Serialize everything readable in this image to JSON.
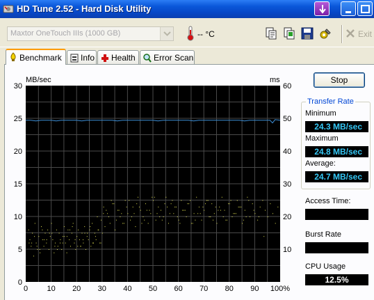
{
  "window": {
    "title": "HD Tune 2.52 - Hard Disk Utility"
  },
  "toolbar": {
    "drive": "Maxtor OneTouch IIIs (1000 GB)",
    "temperature": "-- °C",
    "exit_label": "Exit",
    "icons": [
      "copy-text-icon",
      "copy-image-icon",
      "save-icon",
      "options-icon",
      "exit-icon"
    ]
  },
  "tabs": [
    {
      "label": "Benchmark",
      "icon": "benchmark-icon",
      "active": true
    },
    {
      "label": "Info",
      "icon": "info-icon",
      "active": false
    },
    {
      "label": "Health",
      "icon": "health-icon",
      "active": false
    },
    {
      "label": "Error Scan",
      "icon": "error-scan-icon",
      "active": false
    }
  ],
  "controls": {
    "stop_label": "Stop"
  },
  "transfer_rate": {
    "title": "Transfer Rate",
    "minimum_label": "Minimum",
    "minimum": "24.3 MB/sec",
    "maximum_label": "Maximum",
    "maximum": "24.8 MB/sec",
    "average_label": "Average:",
    "average": "24.7 MB/sec"
  },
  "access_time": {
    "label": "Access Time:",
    "value": ""
  },
  "burst_rate": {
    "label": "Burst Rate",
    "value": ""
  },
  "cpu_usage": {
    "label": "CPU Usage",
    "value": "12.5%"
  },
  "colors": {
    "chart_bg": "#000000",
    "grid": "#4a4a4a",
    "transfer_line": "#3c8fd8",
    "access_dots": "#e4e452",
    "stat_text": "#35c7f5"
  },
  "chart_data": {
    "type": "line",
    "left_unit": "MB/sec",
    "right_unit": "ms",
    "left_ticks": [
      "30",
      "25",
      "20",
      "15",
      "10",
      "5",
      "0"
    ],
    "right_ticks": [
      "60",
      "50",
      "40",
      "30",
      "20",
      "10"
    ],
    "x_ticks": [
      "0",
      "10",
      "20",
      "30",
      "40",
      "50",
      "60",
      "70",
      "80",
      "90",
      "100%"
    ],
    "xlim": [
      0,
      100
    ],
    "ylim_left": [
      0,
      30
    ],
    "ylim_right": [
      0,
      60
    ],
    "grid": true,
    "series": [
      {
        "axis": "left",
        "x": [
          0,
          2,
          4,
          6,
          8,
          10,
          12,
          14,
          16,
          18,
          20,
          22,
          24,
          26,
          28,
          30,
          32,
          34,
          36,
          38,
          40,
          42,
          44,
          46,
          48,
          50,
          52,
          54,
          56,
          58,
          60,
          62,
          64,
          66,
          68,
          70,
          72,
          74,
          76,
          78,
          80,
          82,
          84,
          86,
          88,
          90,
          92,
          94,
          96,
          97,
          98,
          100
        ],
        "values": [
          24.7,
          24.7,
          24.6,
          24.7,
          24.7,
          24.7,
          24.6,
          24.7,
          24.7,
          24.7,
          24.7,
          24.6,
          24.7,
          24.7,
          24.7,
          24.7,
          24.7,
          24.7,
          24.6,
          24.7,
          24.7,
          24.7,
          24.7,
          24.7,
          24.7,
          24.7,
          24.6,
          24.7,
          24.7,
          24.7,
          24.7,
          24.7,
          24.7,
          24.6,
          24.7,
          24.7,
          24.7,
          24.7,
          24.7,
          24.7,
          24.7,
          24.7,
          24.7,
          24.6,
          24.7,
          24.7,
          24.7,
          24.7,
          24.7,
          24.3,
          24.8,
          24.7
        ]
      }
    ],
    "scatter_axis": "right",
    "scatter_x": [
      1,
      1.5,
      2,
      2.5,
      3,
      3.5,
      4,
      4.5,
      5,
      5.5,
      6,
      6.5,
      7,
      7.5,
      8,
      8.5,
      9,
      9.5,
      10,
      10.5,
      11,
      11.5,
      12,
      12.5,
      13,
      13.5,
      14,
      14.5,
      15,
      15.5,
      16,
      16.5,
      17,
      17.5,
      18,
      18.5,
      19,
      19.5,
      20,
      20.5,
      21,
      21.5,
      22,
      22.5,
      23,
      23.5,
      24,
      24.5,
      25,
      25.5,
      26,
      26.5,
      27,
      27.5,
      28,
      28.5,
      29,
      29.5,
      30,
      30.5,
      31,
      32,
      33,
      34,
      35,
      36,
      37,
      38,
      39,
      40,
      41,
      42,
      43,
      44,
      45,
      46,
      47,
      48,
      49,
      50,
      51,
      52,
      53,
      54,
      55,
      56,
      57,
      58,
      59,
      60,
      61,
      62,
      63,
      64,
      65,
      66,
      67,
      68,
      69,
      70,
      71,
      72,
      73,
      74,
      75,
      76,
      77,
      78,
      79,
      80,
      81,
      82,
      83,
      84,
      85,
      86,
      87,
      88,
      89,
      90,
      91,
      92,
      93,
      94,
      95,
      96,
      97,
      98,
      99,
      1.2,
      3.3,
      5.4,
      7.1,
      9.2,
      11.3,
      13.4,
      15.1,
      17.2,
      19.3,
      21.4,
      23.1,
      25.2,
      27.3,
      29.4,
      31.5,
      33.5,
      35.5,
      37.5,
      39.5,
      41.5,
      43.5,
      45.5,
      47.5,
      49.5,
      51.5,
      53.5,
      55.5,
      57.5,
      59.5,
      61.5,
      63.5,
      65.5,
      67.5,
      69.5,
      71.5,
      73.5,
      75.5,
      77.5,
      79.5,
      81.5,
      83.5,
      85.5,
      87.5,
      89.5,
      91.5,
      93.5,
      2.2,
      4.3,
      6.4,
      8.1,
      10.2,
      12.3,
      14.4,
      16.1,
      18.2,
      20.3,
      22.4,
      24.1,
      26.2,
      28.3,
      30.4,
      32.5,
      34.5,
      36.5,
      38.5,
      40.5,
      42.5,
      44.5,
      46.5,
      48.5,
      50.5,
      52.5,
      54.5,
      56.5,
      58.5,
      60.5,
      62.5,
      64.5,
      66.5,
      68.5,
      70.5,
      72.5,
      74.5,
      76.5,
      78.5,
      80.5,
      82.5,
      84.5,
      86.5,
      88.5,
      90.5,
      92.5,
      94.5
    ],
    "scatter_y": [
      16,
      13,
      11,
      15,
      8,
      18,
      12,
      10,
      14,
      9,
      17,
      13,
      11,
      15,
      12,
      16,
      10,
      14,
      18,
      13,
      9,
      12,
      16,
      11,
      15,
      13,
      10,
      14,
      17,
      12,
      9,
      16,
      13,
      11,
      15,
      18,
      12,
      10,
      14,
      16,
      13,
      11,
      15,
      12,
      17,
      10,
      14,
      13,
      16,
      11,
      18,
      12,
      15,
      13,
      20,
      16,
      12,
      19,
      15,
      23,
      17,
      21,
      18,
      24,
      16,
      22,
      20,
      18,
      25,
      21,
      19,
      23,
      17,
      26,
      22,
      20,
      24,
      18,
      21,
      25,
      19,
      23,
      22,
      20,
      26,
      18,
      24,
      21,
      23,
      19,
      25,
      22,
      20,
      24,
      18,
      21,
      26,
      23,
      19,
      22,
      25,
      20,
      24,
      21,
      18,
      23,
      26,
      22,
      19,
      24,
      20,
      21,
      25,
      23,
      18,
      22,
      26,
      20,
      24,
      21,
      19,
      23,
      25,
      22,
      20,
      24,
      21,
      18,
      23,
      12,
      14,
      10,
      13,
      15,
      11,
      12,
      14,
      16,
      13,
      11,
      15,
      17,
      14,
      12,
      22,
      25,
      19,
      21,
      23,
      20,
      24,
      18,
      22,
      26,
      21,
      19,
      23,
      25,
      20,
      22,
      24,
      18,
      21,
      23,
      25,
      19,
      22,
      20,
      24,
      21,
      23,
      19,
      25,
      22,
      20,
      14,
      12,
      11,
      16,
      13,
      15,
      10,
      12,
      14,
      17,
      11,
      13,
      15,
      12,
      16,
      21,
      20,
      24,
      22,
      18,
      25,
      21,
      23,
      19,
      22,
      26,
      20,
      24,
      21,
      23,
      18,
      22,
      25,
      19,
      21,
      24,
      20,
      23,
      22,
      19,
      25,
      21,
      23,
      20
    ]
  }
}
